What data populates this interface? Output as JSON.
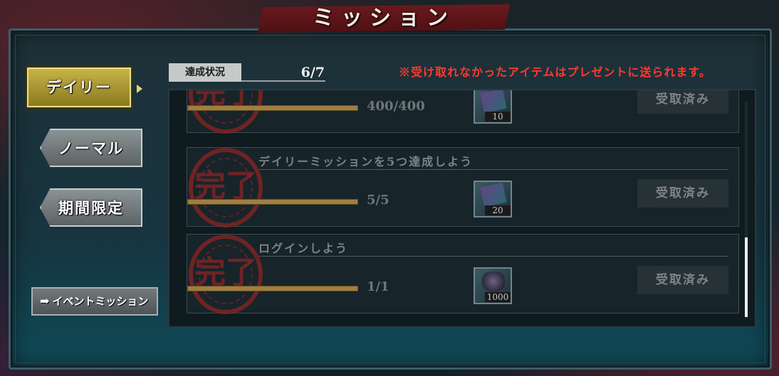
{
  "header": {
    "title": "ミッション"
  },
  "tabs": [
    {
      "label": "デイリー",
      "active": true
    },
    {
      "label": "ノーマル",
      "active": false
    },
    {
      "label": "期間限定",
      "active": false
    }
  ],
  "event_button": {
    "label": "イベントミッション",
    "icon": "arrow-right-icon"
  },
  "progress": {
    "label": "達成状況",
    "value": "6/7"
  },
  "notice": "※受け取れなかったアイテムはプレゼントに送られます。",
  "missions": [
    {
      "title": "",
      "progress": "400/400",
      "fraction": 1.0,
      "stamp": "完了",
      "reward": {
        "icon": "gem-pack-icon",
        "qty": "10"
      },
      "claim_label": "受取済み"
    },
    {
      "title": "デイリーミッションを5つ達成しよう",
      "progress": "5/5",
      "fraction": 1.0,
      "stamp": "完了",
      "reward": {
        "icon": "gem-pack-icon",
        "qty": "20"
      },
      "claim_label": "受取済み"
    },
    {
      "title": "ログインしよう",
      "progress": "1/1",
      "fraction": 1.0,
      "stamp": "完了",
      "reward": {
        "icon": "crystal-item-icon",
        "qty": "1000"
      },
      "claim_label": "受取済み"
    }
  ],
  "colors": {
    "notice": "#ff3a2e",
    "active_tab": "#c9b348",
    "title_plate": "#6b1a1d"
  }
}
